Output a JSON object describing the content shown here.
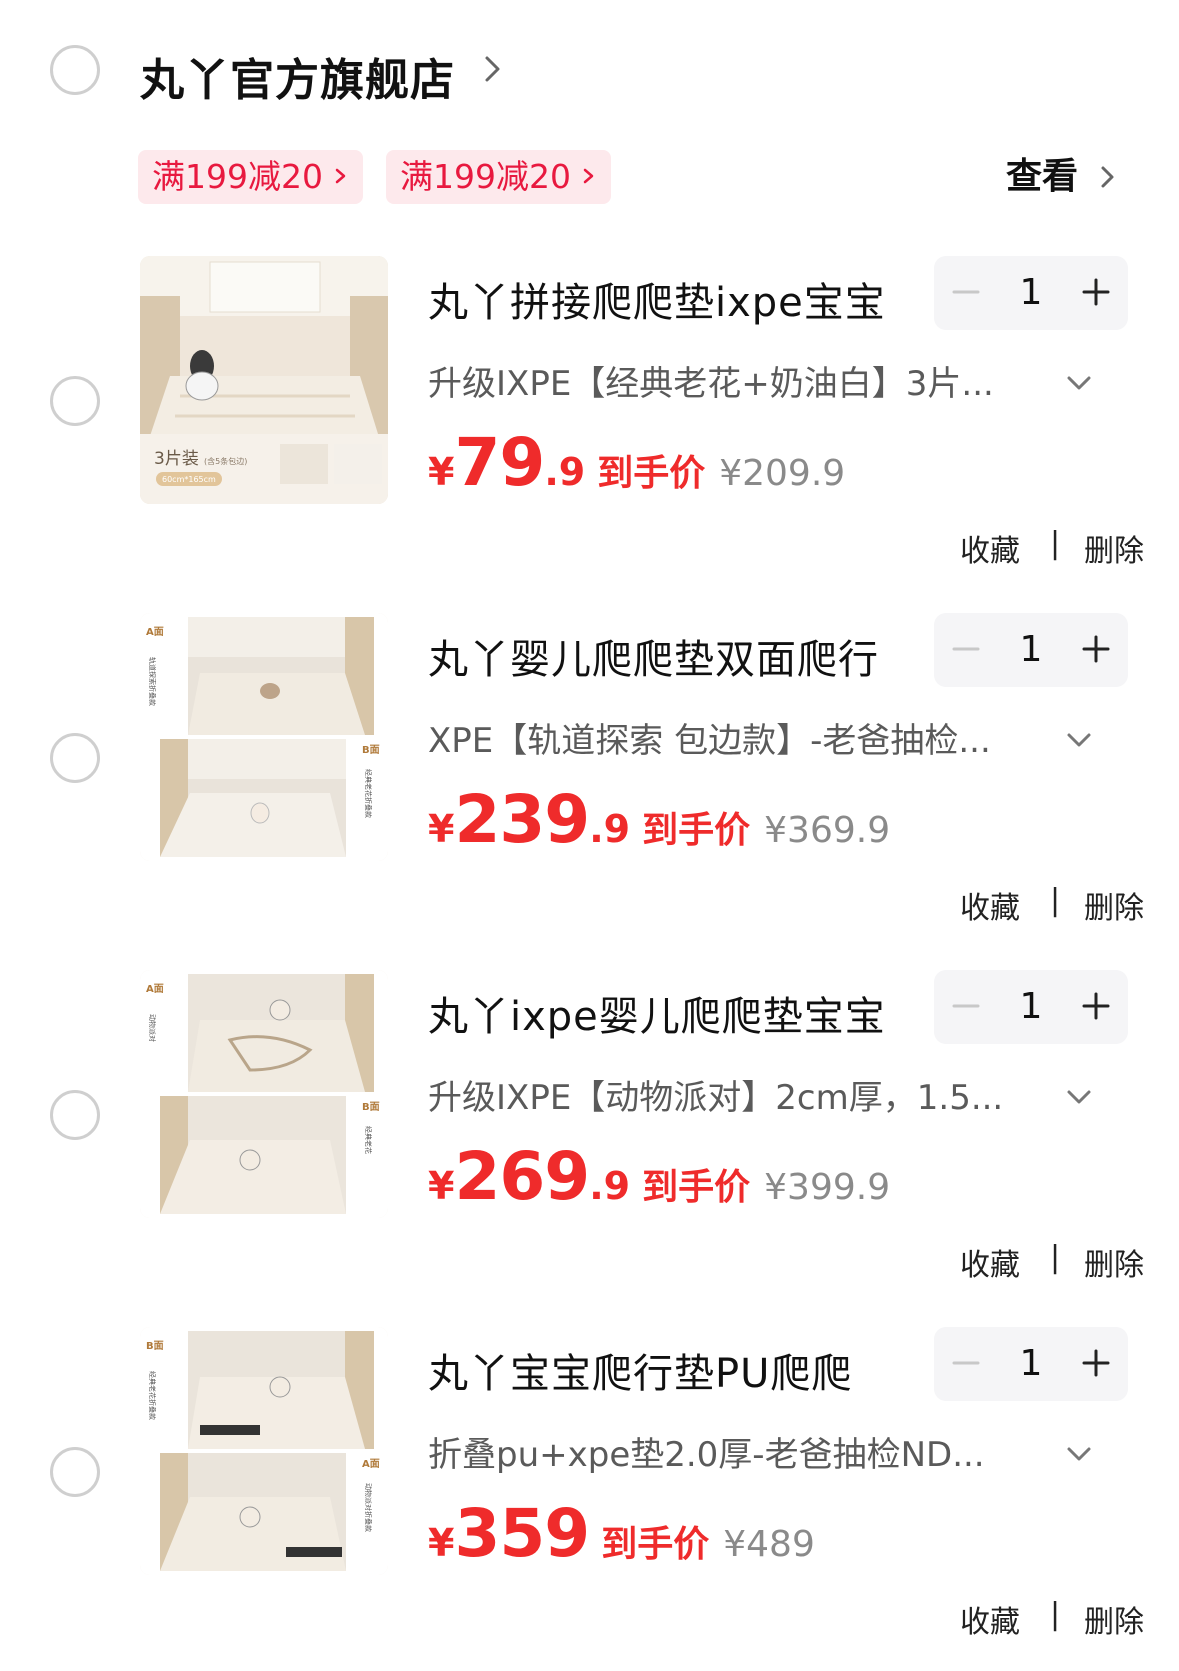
{
  "store": {
    "name": "丸丫官方旗舰店",
    "coupons": [
      "满199减20",
      "满199减20"
    ],
    "view_label": "查看"
  },
  "items": [
    {
      "title": "丸丫拼接爬爬垫ixpe宝宝",
      "spec": "升级IXPE【经典老花+奶油白】3片...",
      "quantity": "1",
      "currency": "¥",
      "price_int": "79",
      "price_dec": ".9",
      "final_label": "到手价",
      "original_price": "¥209.9",
      "fav_label": "收藏",
      "separator": "|",
      "delete_label": "删除",
      "thumb": {
        "label": "3片装",
        "sublabel": "(含5条包边)",
        "size": "60cm*165cm"
      }
    },
    {
      "title": "丸丫婴儿爬爬垫双面爬行",
      "spec": "XPE【轨道探索 包边款】-老爸抽检...",
      "quantity": "1",
      "currency": "¥",
      "price_int": "239",
      "price_dec": ".9",
      "final_label": "到手价",
      "original_price": "¥369.9",
      "fav_label": "收藏",
      "separator": "|",
      "delete_label": "删除",
      "thumb": {
        "side_a": "A面",
        "side_a_text": "轨道探索折叠款",
        "side_b": "B面",
        "side_b_text": "经典老花折叠款"
      }
    },
    {
      "title": "丸丫ixpe婴儿爬爬垫宝宝",
      "spec": "升级IXPE【动物派对】2cm厚，1.5...",
      "quantity": "1",
      "currency": "¥",
      "price_int": "269",
      "price_dec": ".9",
      "final_label": "到手价",
      "original_price": "¥399.9",
      "fav_label": "收藏",
      "separator": "|",
      "delete_label": "删除",
      "thumb": {
        "side_a": "A面",
        "side_a_text": "动物派对",
        "side_b": "B面",
        "side_b_text": "经典老花"
      }
    },
    {
      "title": "丸丫宝宝爬行垫PU爬爬",
      "spec": "折叠pu+xpe垫2.0厚-老爸抽检ND...",
      "quantity": "1",
      "currency": "¥",
      "price_int": "359",
      "price_dec": "",
      "final_label": "到手价",
      "original_price": "¥489",
      "fav_label": "收藏",
      "separator": "|",
      "delete_label": "删除",
      "thumb": {
        "side_a": "B面",
        "side_a_text": "经典老花折叠款",
        "side_b": "A面",
        "side_b_text": "动物派对折叠款"
      }
    }
  ],
  "colors": {
    "price_red": "#ef2b2b",
    "coupon_bg": "#fde9ec",
    "coupon_text": "#e8193f",
    "stepper_bg": "#f5f5f7"
  }
}
